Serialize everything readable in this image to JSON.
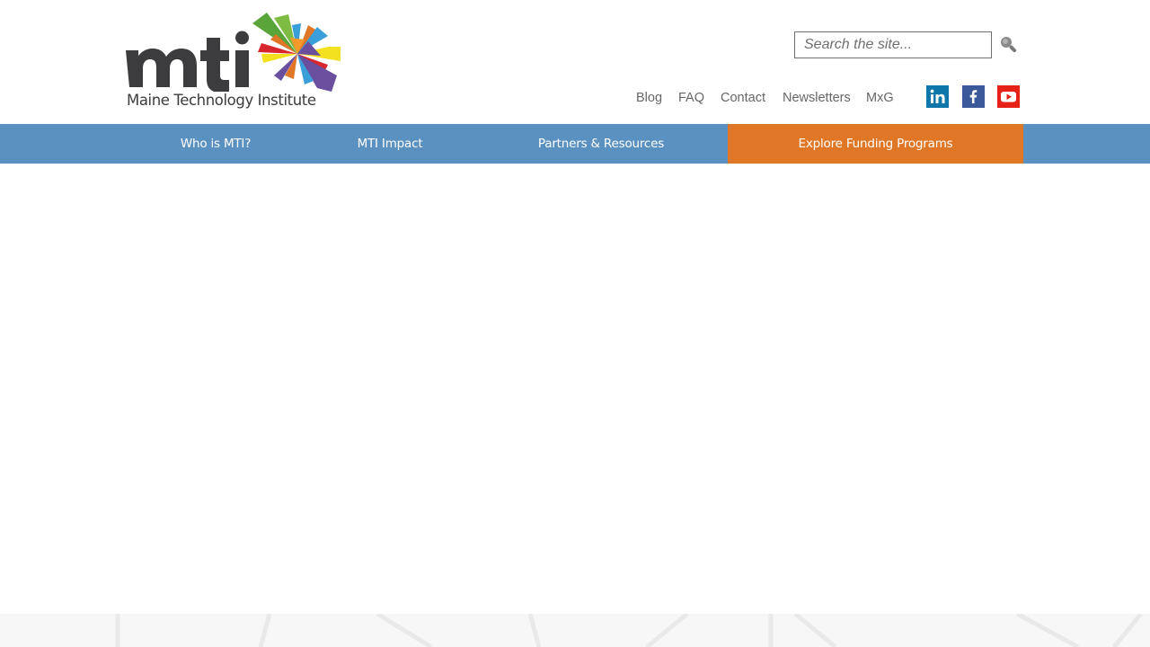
{
  "header": {
    "logo": {
      "wordmark": "mti",
      "subtitle": "Maine Technology Institute"
    },
    "search": {
      "placeholder": "Search the site...",
      "value": "",
      "button_icon": "search-icon"
    },
    "utility_nav": [
      {
        "label": "Blog"
      },
      {
        "label": "FAQ"
      },
      {
        "label": "Contact"
      },
      {
        "label": "Newsletters"
      },
      {
        "label": "MxG"
      }
    ],
    "social": [
      {
        "icon": "linkedin-icon",
        "color": "#0e76a8"
      },
      {
        "icon": "facebook-icon",
        "color": "#3b5998"
      },
      {
        "icon": "youtube-icon",
        "color": "#e62117"
      }
    ]
  },
  "main_nav": {
    "items": [
      {
        "label": "Who is MTI?"
      },
      {
        "label": "MTI Impact"
      },
      {
        "label": "Partners & Resources"
      },
      {
        "label": "Explore Funding Programs"
      }
    ],
    "bar_color": "#5a91c0",
    "cta_color": "#e07727"
  }
}
